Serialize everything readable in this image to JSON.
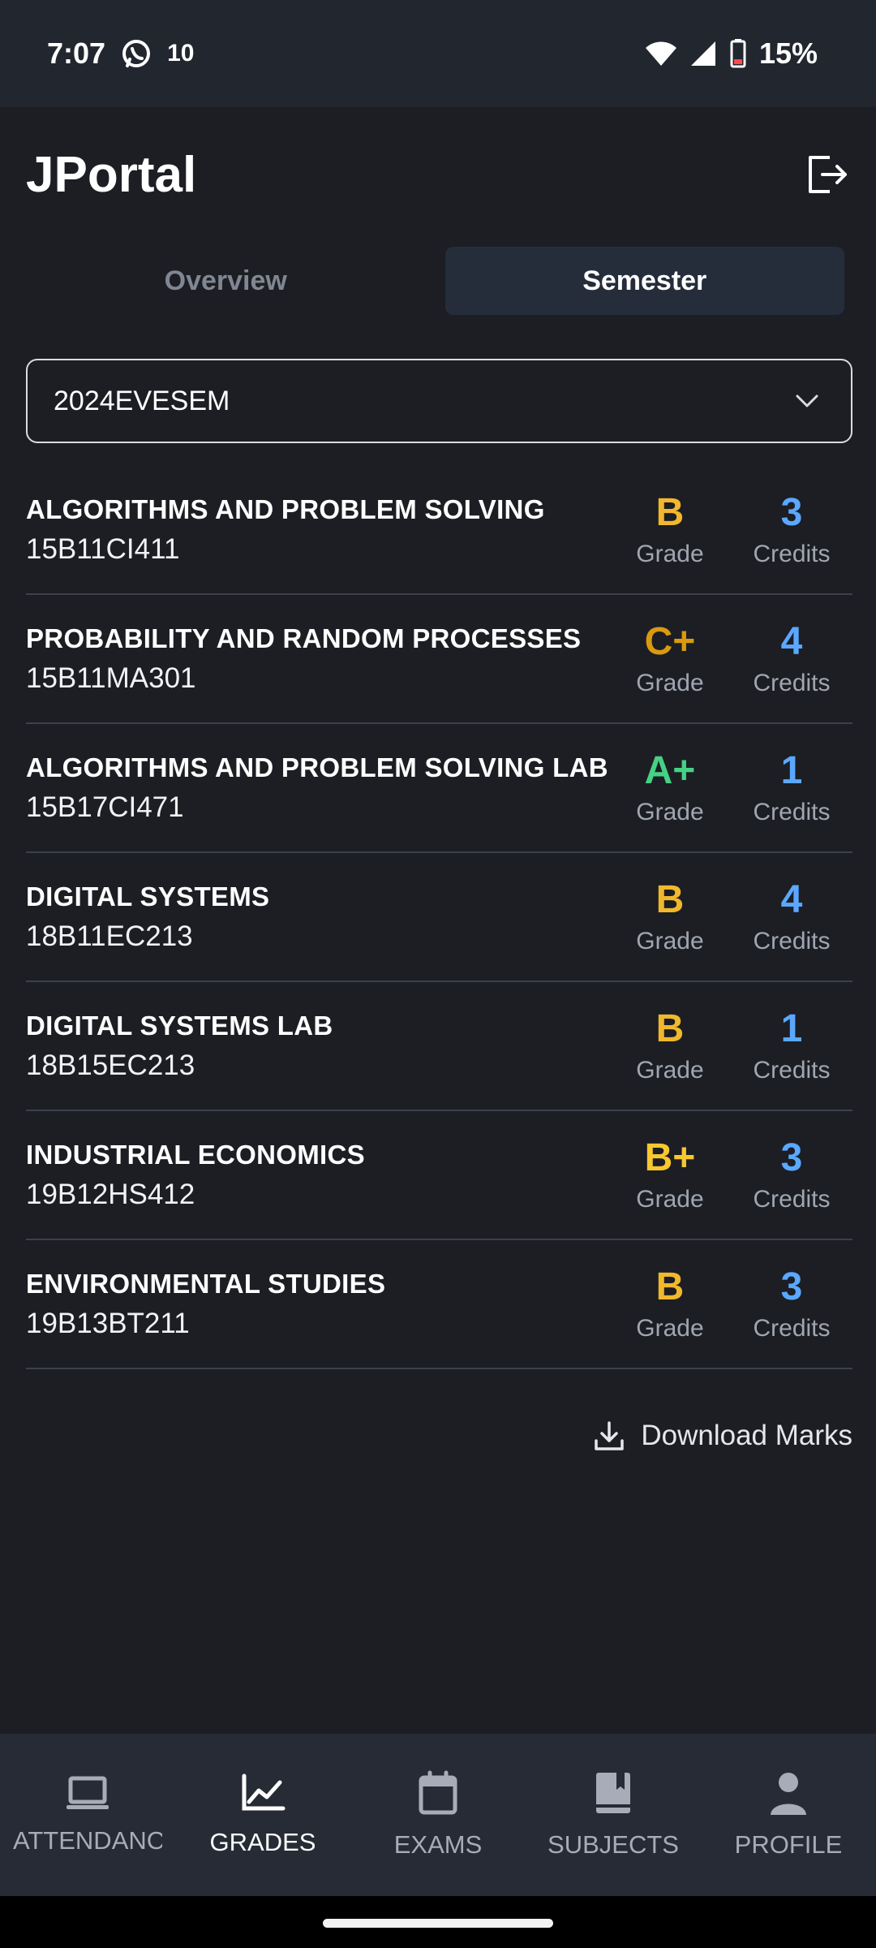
{
  "status_bar": {
    "time": "7:07",
    "data_speed": "10",
    "battery": "15%"
  },
  "app": {
    "title": "JPortal"
  },
  "tabs": [
    {
      "label": "Overview"
    },
    {
      "label": "Semester"
    }
  ],
  "semester_select": {
    "value": "2024EVESEM"
  },
  "labels": {
    "grade": "Grade",
    "credits": "Credits"
  },
  "grades": [
    {
      "name": "ALGORITHMS AND PROBLEM SOLVING",
      "code": "15B11CI411",
      "grade": "B",
      "credits": "3",
      "grade_color": "#f1b82d"
    },
    {
      "name": "PROBABILITY AND RANDOM PROCESSES",
      "code": "15B11MA301",
      "grade": "C+",
      "credits": "4",
      "grade_color": "#d99a10"
    },
    {
      "name": "ALGORITHMS AND PROBLEM SOLVING LAB",
      "code": "15B17CI471",
      "grade": "A+",
      "credits": "1",
      "grade_color": "#46d184"
    },
    {
      "name": "DIGITAL SYSTEMS",
      "code": "18B11EC213",
      "grade": "B",
      "credits": "4",
      "grade_color": "#f1b82d"
    },
    {
      "name": "DIGITAL SYSTEMS LAB",
      "code": "18B15EC213",
      "grade": "B",
      "credits": "1",
      "grade_color": "#f1b82d"
    },
    {
      "name": "INDUSTRIAL ECONOMICS",
      "code": "19B12HS412",
      "grade": "B+",
      "credits": "3",
      "grade_color": "#f7c72f"
    },
    {
      "name": "ENVIRONMENTAL STUDIES",
      "code": "19B13BT211",
      "grade": "B",
      "credits": "3",
      "grade_color": "#f1b82d"
    }
  ],
  "credit_color": "#5aa8ff",
  "download": {
    "label": "Download Marks"
  },
  "bottom_nav": [
    {
      "label": "ATTENDANCE",
      "icon": "laptop-icon"
    },
    {
      "label": "GRADES",
      "icon": "chart-line-icon"
    },
    {
      "label": "EXAMS",
      "icon": "calendar-icon"
    },
    {
      "label": "SUBJECTS",
      "icon": "book-icon"
    },
    {
      "label": "PROFILE",
      "icon": "person-icon"
    }
  ]
}
